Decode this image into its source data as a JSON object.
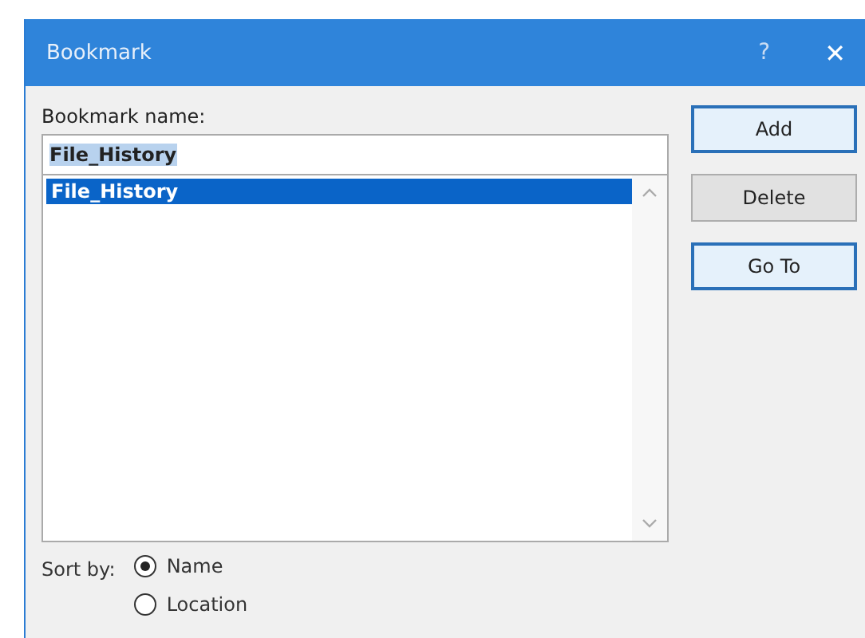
{
  "window": {
    "title": "Bookmark",
    "help": "?",
    "close": "✕"
  },
  "name_label": "Bookmark name:",
  "name_field": {
    "value": "File_History"
  },
  "bookmarks": [
    {
      "label": "File_History",
      "selected": true
    }
  ],
  "buttons": [
    {
      "label": "Add",
      "highlighted": true
    },
    {
      "label": "Delete",
      "highlighted": false
    },
    {
      "label": "Go To",
      "highlighted": true
    }
  ],
  "sort": {
    "label": "Sort by:",
    "options": [
      {
        "label": "Name",
        "selected": true
      },
      {
        "label": "Location",
        "selected": false
      }
    ]
  }
}
